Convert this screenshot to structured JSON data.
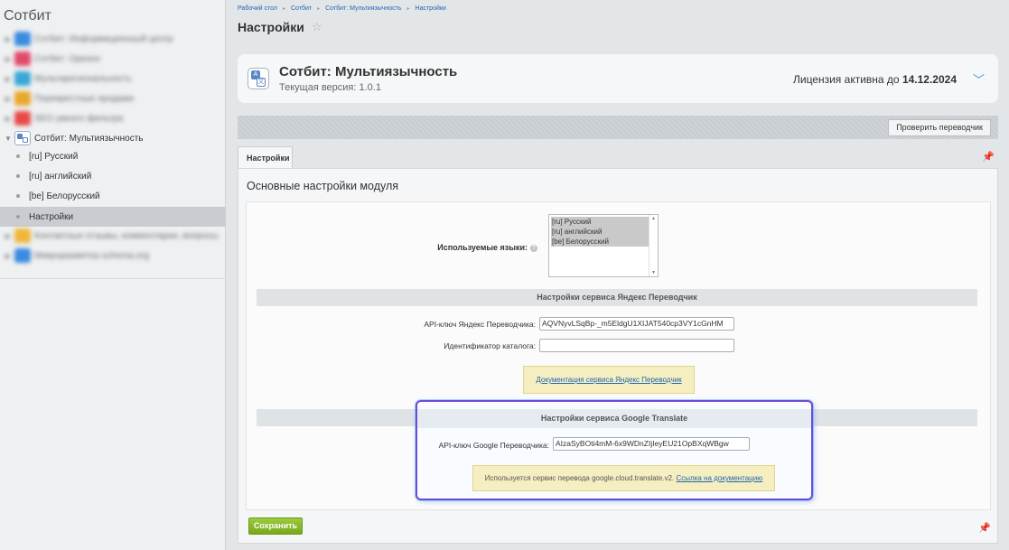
{
  "sidebar": {
    "title": "Сотбит",
    "blurred_items": [
      {
        "label": "Сотбит: Информационный центр",
        "color": "#3b8be0"
      },
      {
        "label": "Сотбит: Оризон",
        "color": "#e24a6b"
      },
      {
        "label": "Мультирегиональность",
        "color": "#3aa7d6"
      },
      {
        "label": "Перекрестные продажи",
        "color": "#e9a72b"
      },
      {
        "label": "SEO умного фильтра",
        "color": "#e84a4a"
      }
    ],
    "expanded_item": {
      "label": "Сотбит: Мультиязычность"
    },
    "sub_items": [
      {
        "label": "[ru] Русский"
      },
      {
        "label": "[ru] английский"
      },
      {
        "label": "[be] Белорусский"
      },
      {
        "label": "Настройки"
      }
    ],
    "blurred_items_after": [
      {
        "label": "Контактные отзывы, комментарии, вопросы",
        "color": "#f0b63a"
      },
      {
        "label": "Микроразметка schema.org",
        "color": "#3b8be0"
      }
    ]
  },
  "breadcrumb": [
    "Рабочий стол",
    "Сотбит",
    "Сотбит: Мультиязычность",
    "Настройки"
  ],
  "page_title": "Настройки",
  "module": {
    "name": "Сотбит: Мультиязычность",
    "version": "Текущая версия: 1.0.1",
    "license_prefix": "Лицензия активна до",
    "license_date": "14.12.2024"
  },
  "toolbar": {
    "check_translator": "Проверить переводчик"
  },
  "tabs": [
    {
      "label": "Настройки"
    }
  ],
  "content": {
    "section_title": "Основные настройки модуля",
    "languages_label": "Используемые языки:",
    "languages": [
      "[ru] Русский",
      "[ru] английский",
      "[be] Белорусский"
    ],
    "yandex": {
      "header": "Настройки сервиса Яндекс Переводчик",
      "api_label": "API-ключ Яндекс Переводчика:",
      "api_value": "AQVNyvLSqBp-_m5EldgU1XIJAT540cp3VY1cGnHM",
      "catalog_label": "Идентификатор каталога:",
      "catalog_value": "",
      "doc_link": "Документация сервиса Яндекс Переводчик"
    },
    "google": {
      "header": "Настройки сервиса Google Translate",
      "api_label": "API-ключ Google Переводчика:",
      "api_value": "AIzaSyBOti4mM-6x9WDnZIjIeyEU21OpBXqWBgw",
      "notice_text": "Используется сервис перевода google.cloud.translate.v2.",
      "notice_link": "Ссылка на документацию"
    }
  },
  "save_button": "Сохранить"
}
